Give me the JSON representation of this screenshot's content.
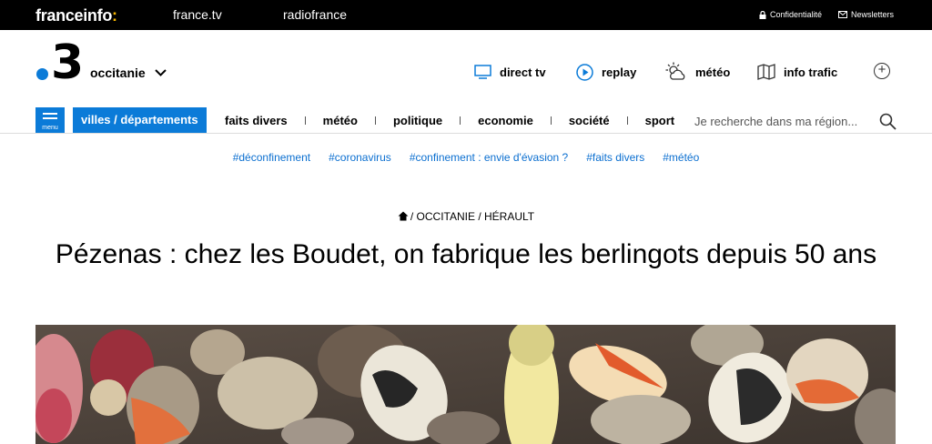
{
  "topbar": {
    "brand": "franceinfo",
    "brand_colon": ":",
    "link_tv": "france.tv",
    "link_radio": "radiofrance",
    "privacy": "Confidentialité",
    "newsletters": "Newsletters"
  },
  "logo": {
    "number": "3",
    "region": "occitanie"
  },
  "quick_links": {
    "direct": "direct tv",
    "replay": "replay",
    "meteo": "météo",
    "trafic": "info trafic"
  },
  "nav": {
    "menu_label": "menu",
    "villes": "villes / départements",
    "items": [
      "faits divers",
      "météo",
      "politique",
      "economie",
      "société",
      "sport"
    ],
    "search_placeholder": "Je recherche dans ma région..."
  },
  "hashtags": [
    "#déconfinement",
    "#coronavirus",
    "#confinement : envie d'évasion ?",
    "#faits divers",
    "#météo"
  ],
  "breadcrumb": "/ OCCITANIE / HÉRAULT",
  "article": {
    "title": "Pézenas : chez les Boudet, on fabrique les berlingots depuis 50 ans"
  },
  "colors": {
    "accent": "#0b7bd8",
    "brand_colon": "#f4b400",
    "tag": "#0b6fd0"
  }
}
